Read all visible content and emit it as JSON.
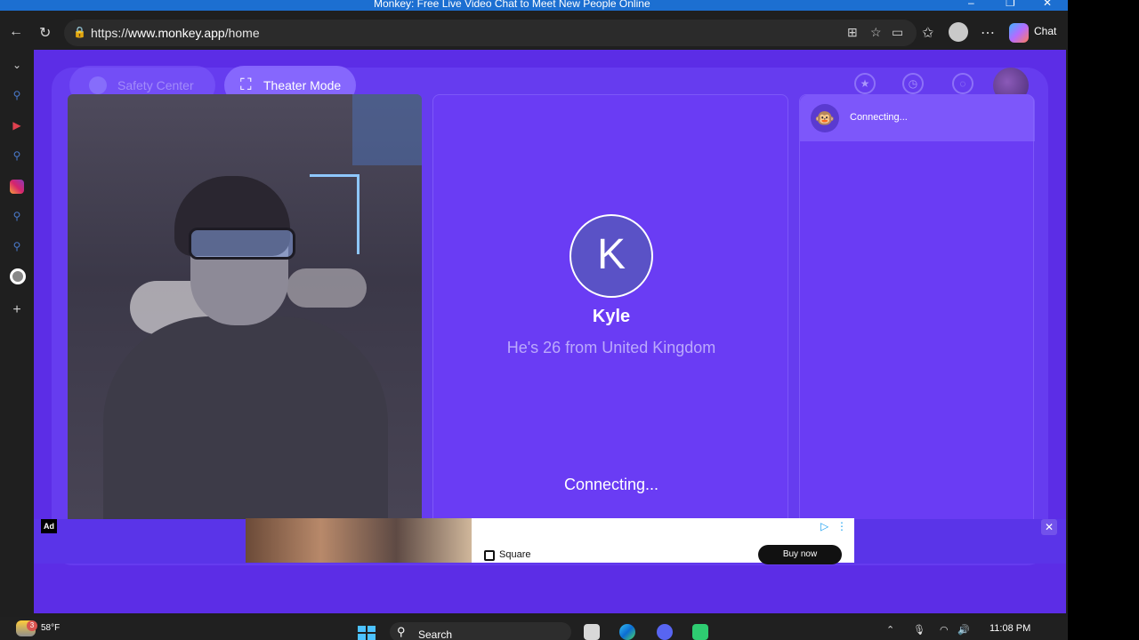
{
  "window": {
    "title": "Monkey: Free Live Video Chat to Meet New People Online",
    "minimize": "–",
    "restore": "❐",
    "close": "✕"
  },
  "browser": {
    "url_prefix": "https://",
    "url_host": "www.monkey.app",
    "url_path": "/home",
    "chat_label": "Chat"
  },
  "toolbar_buttons": {
    "safety_center": "Safety Center",
    "theater_mode": "Theater Mode"
  },
  "profile": {
    "initial": "K",
    "name": "Kyle",
    "info": "He's 26 from United Kingdom",
    "status": "Connecting..."
  },
  "chat_panel": {
    "status": "Connecting..."
  },
  "ad": {
    "tag": "Ad",
    "brand": "Square",
    "cta": "Buy now",
    "close": "✕"
  },
  "taskbar": {
    "temperature": "58°F",
    "weather_badge": "3",
    "search_label": "Search",
    "time": "11:08 PM"
  },
  "colors": {
    "page_bg": "#5c2de6",
    "panel_bg": "#6a3cf4",
    "accent": "#1c6fd1"
  }
}
